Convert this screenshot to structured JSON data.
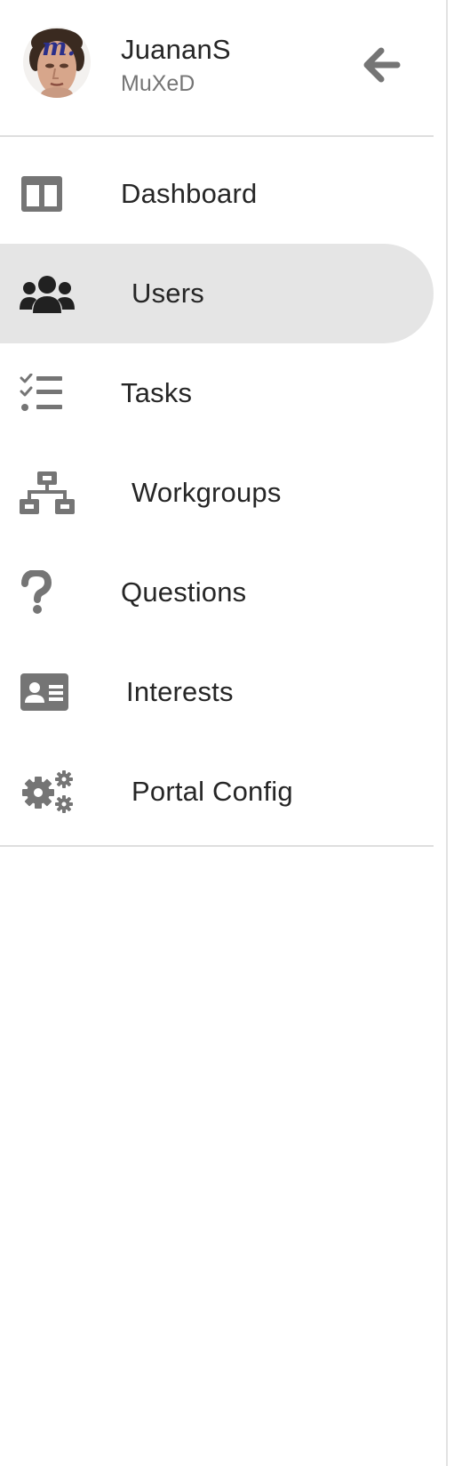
{
  "user": {
    "name": "JuananS",
    "organization": "MuXeD",
    "avatar_icon": "user-avatar-photo"
  },
  "header": {
    "back_icon": "arrow-left-icon"
  },
  "nav": {
    "items": [
      {
        "label": "Dashboard",
        "icon": "dashboard-columns-icon",
        "active": false
      },
      {
        "label": "Users",
        "icon": "users-group-icon",
        "active": true
      },
      {
        "label": "Tasks",
        "icon": "tasks-checklist-icon",
        "active": false
      },
      {
        "label": "Workgroups",
        "icon": "sitemap-icon",
        "active": false
      },
      {
        "label": "Questions",
        "icon": "question-mark-icon",
        "active": false
      },
      {
        "label": "Interests",
        "icon": "id-card-icon",
        "active": false
      },
      {
        "label": "Portal Config",
        "icon": "cogs-icon",
        "active": false
      }
    ]
  },
  "colors": {
    "icon_gray": "#757575",
    "icon_active": "#212121",
    "active_background": "#e5e5e5",
    "text": "#262626",
    "subtext": "#757575",
    "divider": "#dedede"
  }
}
